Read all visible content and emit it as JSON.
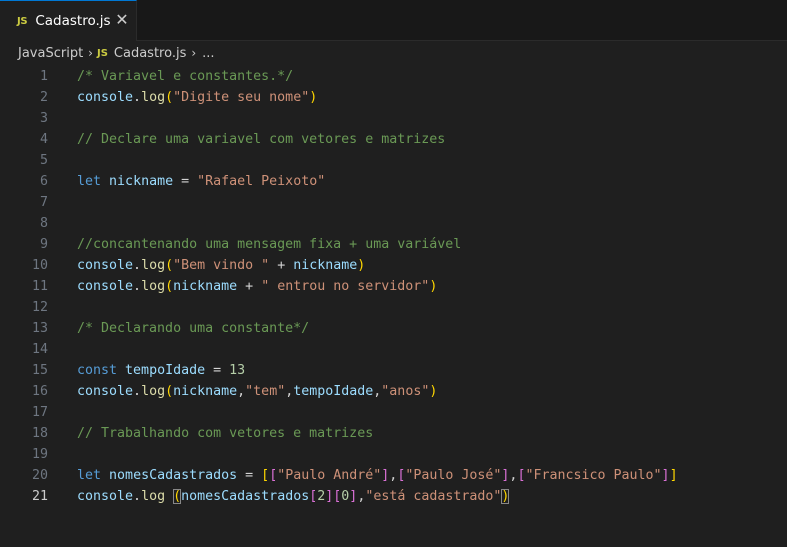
{
  "tab": {
    "icon_text": "JS",
    "label": "Cadastro.js",
    "close_glyph": "✕"
  },
  "breadcrumb": {
    "language": "JavaScript",
    "icon_text": "JS",
    "file": "Cadastro.js",
    "more": "...",
    "separator": "›"
  },
  "active_line": 21,
  "code_lines": [
    {
      "n": 1,
      "tokens": [
        {
          "t": "comment",
          "v": "/* Variavel e constantes.*/"
        }
      ]
    },
    {
      "n": 2,
      "tokens": [
        {
          "t": "var",
          "v": "console"
        },
        {
          "t": "punc",
          "v": "."
        },
        {
          "t": "fn",
          "v": "log"
        },
        {
          "t": "paren",
          "v": "("
        },
        {
          "t": "str",
          "v": "\"Digite seu nome\""
        },
        {
          "t": "paren",
          "v": ")"
        }
      ]
    },
    {
      "n": 3,
      "tokens": []
    },
    {
      "n": 4,
      "tokens": [
        {
          "t": "comment",
          "v": "// Declare uma variavel com vetores e matrizes"
        }
      ]
    },
    {
      "n": 5,
      "tokens": []
    },
    {
      "n": 6,
      "tokens": [
        {
          "t": "kw",
          "v": "let"
        },
        {
          "t": "punc",
          "v": " "
        },
        {
          "t": "var",
          "v": "nickname"
        },
        {
          "t": "punc",
          "v": " = "
        },
        {
          "t": "str",
          "v": "\"Rafael Peixoto\""
        }
      ]
    },
    {
      "n": 7,
      "tokens": []
    },
    {
      "n": 8,
      "tokens": []
    },
    {
      "n": 9,
      "tokens": [
        {
          "t": "comment",
          "v": "//concantenando uma mensagem fixa + uma variável"
        }
      ]
    },
    {
      "n": 10,
      "tokens": [
        {
          "t": "var",
          "v": "console"
        },
        {
          "t": "punc",
          "v": "."
        },
        {
          "t": "fn",
          "v": "log"
        },
        {
          "t": "paren",
          "v": "("
        },
        {
          "t": "str",
          "v": "\"Bem vindo \""
        },
        {
          "t": "punc",
          "v": " + "
        },
        {
          "t": "var",
          "v": "nickname"
        },
        {
          "t": "paren",
          "v": ")"
        }
      ]
    },
    {
      "n": 11,
      "tokens": [
        {
          "t": "var",
          "v": "console"
        },
        {
          "t": "punc",
          "v": "."
        },
        {
          "t": "fn",
          "v": "log"
        },
        {
          "t": "paren",
          "v": "("
        },
        {
          "t": "var",
          "v": "nickname"
        },
        {
          "t": "punc",
          "v": " + "
        },
        {
          "t": "str",
          "v": "\" entrou no servidor\""
        },
        {
          "t": "paren",
          "v": ")"
        }
      ]
    },
    {
      "n": 12,
      "tokens": []
    },
    {
      "n": 13,
      "tokens": [
        {
          "t": "comment",
          "v": "/* Declarando uma constante*/"
        }
      ]
    },
    {
      "n": 14,
      "tokens": []
    },
    {
      "n": 15,
      "tokens": [
        {
          "t": "kw",
          "v": "const"
        },
        {
          "t": "punc",
          "v": " "
        },
        {
          "t": "var",
          "v": "tempoIdade"
        },
        {
          "t": "punc",
          "v": " = "
        },
        {
          "t": "num",
          "v": "13"
        }
      ]
    },
    {
      "n": 16,
      "tokens": [
        {
          "t": "var",
          "v": "console"
        },
        {
          "t": "punc",
          "v": "."
        },
        {
          "t": "fn",
          "v": "log"
        },
        {
          "t": "paren",
          "v": "("
        },
        {
          "t": "var",
          "v": "nickname"
        },
        {
          "t": "punc",
          "v": ","
        },
        {
          "t": "str",
          "v": "\"tem\""
        },
        {
          "t": "punc",
          "v": ","
        },
        {
          "t": "var",
          "v": "tempoIdade"
        },
        {
          "t": "punc",
          "v": ","
        },
        {
          "t": "str",
          "v": "\"anos\""
        },
        {
          "t": "paren",
          "v": ")"
        }
      ]
    },
    {
      "n": 17,
      "tokens": []
    },
    {
      "n": 18,
      "tokens": [
        {
          "t": "comment",
          "v": "// Trabalhando com vetores e matrizes"
        }
      ]
    },
    {
      "n": 19,
      "tokens": []
    },
    {
      "n": 20,
      "tokens": [
        {
          "t": "kw",
          "v": "let"
        },
        {
          "t": "punc",
          "v": " "
        },
        {
          "t": "var",
          "v": "nomesCadastrados"
        },
        {
          "t": "punc",
          "v": " = "
        },
        {
          "t": "paren",
          "v": "["
        },
        {
          "t": "bracket2",
          "v": "["
        },
        {
          "t": "str",
          "v": "\"Paulo André\""
        },
        {
          "t": "bracket2",
          "v": "]"
        },
        {
          "t": "punc",
          "v": ","
        },
        {
          "t": "bracket2",
          "v": "["
        },
        {
          "t": "str",
          "v": "\"Paulo José\""
        },
        {
          "t": "bracket2",
          "v": "]"
        },
        {
          "t": "punc",
          "v": ","
        },
        {
          "t": "bracket2",
          "v": "["
        },
        {
          "t": "str",
          "v": "\"Francsico Paulo\""
        },
        {
          "t": "bracket2",
          "v": "]"
        },
        {
          "t": "paren",
          "v": "]"
        }
      ]
    },
    {
      "n": 21,
      "tokens": [
        {
          "t": "var",
          "v": "console"
        },
        {
          "t": "punc",
          "v": "."
        },
        {
          "t": "fn",
          "v": "log"
        },
        {
          "t": "punc",
          "v": " "
        },
        {
          "t": "paren-match",
          "v": "("
        },
        {
          "t": "var",
          "v": "nomesCadastrados"
        },
        {
          "t": "bracket2",
          "v": "["
        },
        {
          "t": "num",
          "v": "2"
        },
        {
          "t": "bracket2",
          "v": "]"
        },
        {
          "t": "bracket2",
          "v": "["
        },
        {
          "t": "num",
          "v": "0"
        },
        {
          "t": "bracket2",
          "v": "]"
        },
        {
          "t": "punc",
          "v": ","
        },
        {
          "t": "str",
          "v": "\"está cadastrado\""
        },
        {
          "t": "paren-match",
          "v": ")"
        }
      ]
    }
  ],
  "colors": {
    "background": "#1f1f1f",
    "comment": "#6a9955",
    "keyword": "#569cd6",
    "variable": "#9cdcfe",
    "function": "#dcdcaa",
    "string": "#ce9178",
    "number": "#b5cea8",
    "bracket_level1": "#ffd700",
    "bracket_level2": "#da70d6",
    "js_icon": "#cbcb41"
  }
}
